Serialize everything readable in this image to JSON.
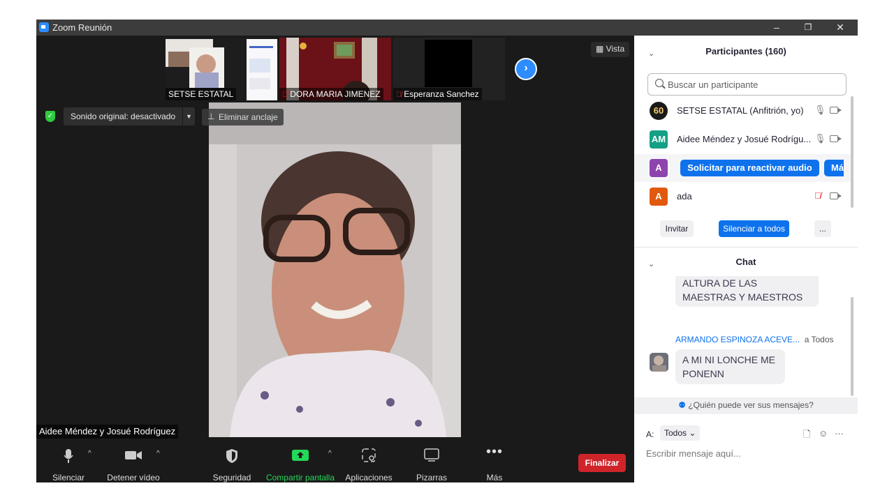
{
  "window": {
    "title": "Zoom Reunión",
    "minimize": "–",
    "restore": "❐",
    "close": "✕"
  },
  "thumbnails": [
    {
      "name": "SETSE ESTATAL",
      "muted": false
    },
    {
      "name": "DORA MARIA JIMENEZ",
      "muted": true
    },
    {
      "name": "Esperanza Sanchez",
      "muted": true
    }
  ],
  "view_button": "Vista",
  "original_sound": "Sonido original: desactivado",
  "unpin": "Eliminar anclaje",
  "active_speaker": "Aidee Méndez y Josué Rodríguez",
  "toolbar": {
    "mute": "Silenciar",
    "stop_video": "Detener vídeo",
    "security": "Seguridad",
    "share": "Compartir pantalla",
    "apps": "Aplicaciones",
    "whiteboards": "Pizarras",
    "more": "Más",
    "end": "Finalizar"
  },
  "participants": {
    "header": "Participantes (160)",
    "search_placeholder": "Buscar un participante",
    "rows": [
      {
        "avatar": "60",
        "name": "SETSE ESTATAL (Anfitrión, yo)",
        "color": "#1a1a1a",
        "muted": false
      },
      {
        "avatar": "AM",
        "name": "Aidee Méndez y Josué Rodrígu...",
        "color": "#14a085",
        "muted": false
      },
      {
        "avatar": "A",
        "name": "",
        "color": "#8e44ad",
        "muted": false
      },
      {
        "avatar": "A",
        "name": "ada",
        "color": "#e0590f",
        "muted": true
      }
    ],
    "ask_unmute": "Solicitar para reactivar audio",
    "more_short": "Má",
    "invite": "Invitar",
    "mute_all": "Silenciar a todos",
    "ellipsis": "..."
  },
  "chat": {
    "header": "Chat",
    "messages": [
      {
        "text": "ALTURA DE LAS MAESTRAS Y MAESTROS"
      },
      {
        "sender": "ARMANDO ESPINOZA ACEVE...",
        "recipient": "a Todos",
        "text": "A MI NI LONCHE ME PONENN"
      }
    ],
    "who_can_see": "¿Quién puede ver sus mensajes?",
    "to_label": "A:",
    "to_value": "Todos",
    "placeholder": "Escribir mensaje aquí..."
  },
  "colors": {
    "accent": "#0e72ed",
    "zoom_blue": "#2d8cff",
    "end_red": "#d0242b",
    "share_green": "#23d959"
  }
}
